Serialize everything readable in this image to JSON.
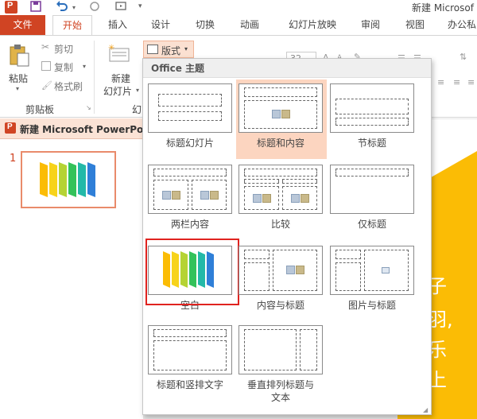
{
  "window": {
    "title": "新建 Microsof"
  },
  "tabs": [
    {
      "label": "文件"
    },
    {
      "label": "开始"
    },
    {
      "label": "插入"
    },
    {
      "label": "设计"
    },
    {
      "label": "切换"
    },
    {
      "label": "动画"
    },
    {
      "label": "幻灯片放映"
    },
    {
      "label": "审阅"
    },
    {
      "label": "视图"
    },
    {
      "label": "办公私"
    }
  ],
  "ribbon": {
    "paste": "粘贴",
    "cut": "剪切",
    "copy": "复制",
    "format_painter": "格式刷",
    "clipboard_group": "剪贴板",
    "new_slide_line1": "新建",
    "new_slide_line2": "幻灯片",
    "slides_group_partial": "幻",
    "layout_btn": "版式",
    "font_size": "32"
  },
  "slide_panel": {
    "header": "新建 Microsoft PowerPo",
    "slide_number": "1"
  },
  "dropdown": {
    "header": "Office 主题",
    "layouts": [
      {
        "name": "标题幻灯片"
      },
      {
        "name": "标题和内容"
      },
      {
        "name": "节标题"
      },
      {
        "name": "两栏内容"
      },
      {
        "name": "比较"
      },
      {
        "name": "仅标题"
      },
      {
        "name": "空白"
      },
      {
        "name": "内容与标题"
      },
      {
        "name": "图片与标题"
      },
      {
        "name": "标题和竖排文字"
      },
      {
        "name": "垂直排列标题与",
        "name_line2": "文本"
      }
    ]
  },
  "canvas_text": [
    "子",
    "羽,",
    "乐",
    "上"
  ],
  "colors": {
    "accent": "#d04423",
    "slide_yellow": "#fbbc05",
    "selected_layout_bg": "#fcd5c0",
    "highlight_frame": "#e0231f"
  }
}
